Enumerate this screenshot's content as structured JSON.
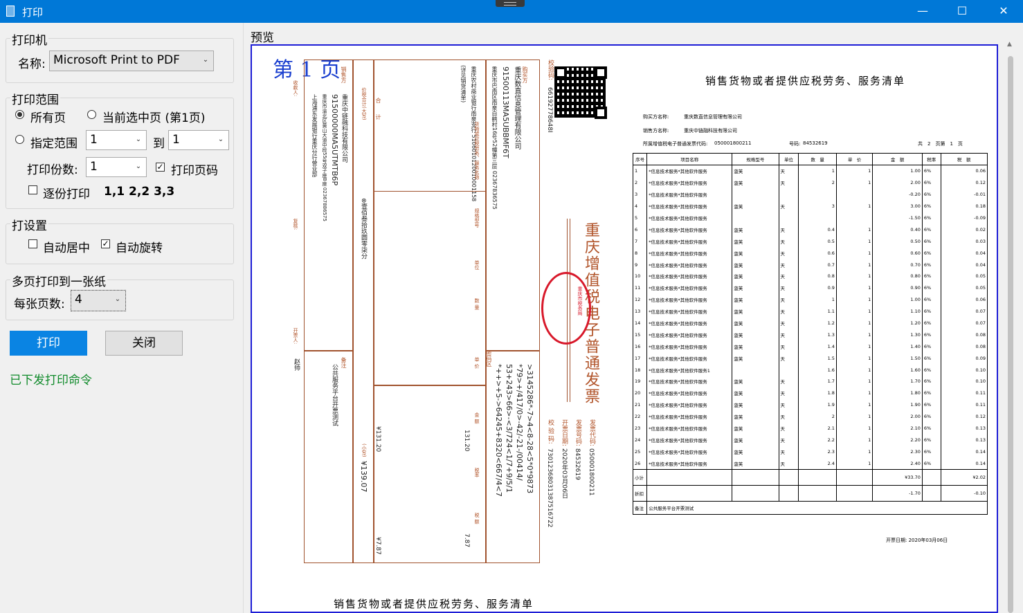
{
  "window": {
    "title": "打印",
    "minimize": "—",
    "maximize": "☐",
    "close": "✕"
  },
  "printer": {
    "group": "打印机",
    "name_label": "名称:",
    "name_value": "Microsoft Print to PDF"
  },
  "range": {
    "group": "打印范围",
    "all_pages": "所有页",
    "current_page": "当前选中页 (第1页)",
    "specified": "指定范围",
    "from": "1",
    "to_label": "到",
    "to": "1",
    "copies_label": "打印份数:",
    "copies": "1",
    "print_page_numbers": "打印页码",
    "collate": "逐份打印",
    "collate_example": "1,1 2,2 3,3"
  },
  "settings": {
    "group": "打设置",
    "center": "自动居中",
    "rotate": "自动旋转"
  },
  "multipage": {
    "group": "多页打印到一张纸",
    "per_sheet_label": "每张页数:",
    "per_sheet": "4"
  },
  "buttons": {
    "print": "打印",
    "close": "关闭"
  },
  "status": "已下发打印命令",
  "preview": {
    "label": "预览",
    "page_label": "第 1 页",
    "invoice": {
      "code_label": "校验码:",
      "code_value": "66192778648I",
      "buyer_name_label": "名　　　称:",
      "buyer_name": "重庆数直信息管理有限公司",
      "buyer_tax_label": "纳税人识别号:",
      "buyer_tax": "91500113MA5UBBMF6T",
      "buyer_addr_label": "地址、电话:",
      "buyer_addr": "重庆市巴南区南泉白鹤村16号52幢第三层 02367836575",
      "buyer_bank_label": "开户行及账号:",
      "buyer_bank": "重庆农村商业银行南泉支行 5106010120010001158",
      "buyer_side": "购买方",
      "password_label": "密码区",
      "password": [
        ">3145286*-7>4<8-28<5*0*9873",
        "*79>+/417/0>-42/-21-/00414/",
        "53+243>66>-<3/724<1/7+9/5/1",
        "*++>+5->64245+8320<667/4<7"
      ],
      "goods_col": "货物或应税劳务、服务名称",
      "goods_value": "(详见销货清单)",
      "spec_col": "规格型号",
      "unit_col": "单位",
      "qty_col": "数 量",
      "price_col": "单 价",
      "amount_col": "金 额",
      "tax_rate_col": "税率",
      "tax_col": "税 额",
      "amount": "131.20",
      "tax": "7.87",
      "total_label": "合　　计",
      "total_amount": "¥131.20",
      "total_tax": "¥7.87",
      "grand_label": "价税合计(大写)",
      "grand_words": "⊗壹佰叁拾玖圆零柒分",
      "grand_small_label": "(小写)",
      "grand_small": "¥139.07",
      "seller_side": "销售方",
      "seller_name": "重庆中链融科技有限公司",
      "seller_tax": "91500000MA5UTMTB6P",
      "seller_addr": "重庆市渝北区黄山大道中段55号双子座B座 02367886575",
      "seller_bank": "上海浦东发展银行重庆分行营业部",
      "remarks_label": "备注",
      "remarks": "公共服务平台开票测试",
      "payee_label": "收款人:",
      "reviewer_label": "复核:",
      "drawer_label": "开票人:",
      "drawer": "赵帅",
      "invoice_title": "重庆增值税电子普通发票",
      "inv_code_label": "发票代码:",
      "inv_code": "050001800211",
      "inv_no_label": "发票号码:",
      "inv_no": "84532619",
      "date_label": "开票日期:",
      "date": "2020年03月06日",
      "check_label": "校 验 码:",
      "check": "73012368031387516722"
    },
    "list": {
      "title": "销售货物或者提供应税劳务、服务清单",
      "buyer_label": "购买方名称:",
      "buyer": "重庆数直信息管理有限公司",
      "seller_label": "销售方名称:",
      "seller": "重庆中链融科技有限公司",
      "code_label": "所属增值税电子普通发票代码:",
      "code": "050001800211",
      "no_label": "号码:",
      "no": "84532619",
      "pages_total": "共　2　页第　1　页",
      "headers": [
        "序号",
        "项目名称",
        "规格型号",
        "单位",
        "数　量",
        "单　价",
        "金　额",
        "税率",
        "税　额"
      ],
      "rows": [
        [
          "1",
          "*信息技术服务*其他软件服务",
          "菠芙",
          "天",
          "1",
          "1",
          "1.00",
          "6%",
          "0.06"
        ],
        [
          "2",
          "*信息技术服务*其他软件服务",
          "菠芙",
          "天",
          "2",
          "1",
          "2.00",
          "6%",
          "0.12"
        ],
        [
          "3",
          "*信息技术服务*其他软件服务",
          "",
          "",
          "",
          "",
          "-0.20",
          "6%",
          "-0.01"
        ],
        [
          "4",
          "*信息技术服务*其他软件服务",
          "菠芙",
          "天",
          "3",
          "1",
          "3.00",
          "6%",
          "0.18"
        ],
        [
          "5",
          "*信息技术服务*其他软件服务",
          "",
          "",
          "",
          "",
          "-1.50",
          "6%",
          "-0.09"
        ],
        [
          "6",
          "*信息技术服务*其他软件服务",
          "菠芙",
          "天",
          "0.4",
          "1",
          "0.40",
          "6%",
          "0.02"
        ],
        [
          "7",
          "*信息技术服务*其他软件服务",
          "菠芙",
          "天",
          "0.5",
          "1",
          "0.50",
          "6%",
          "0.03"
        ],
        [
          "8",
          "*信息技术服务*其他软件服务",
          "菠芙",
          "天",
          "0.6",
          "1",
          "0.60",
          "6%",
          "0.04"
        ],
        [
          "9",
          "*信息技术服务*其他软件服务",
          "菠芙",
          "天",
          "0.7",
          "1",
          "0.70",
          "6%",
          "0.04"
        ],
        [
          "10",
          "*信息技术服务*其他软件服务",
          "菠芙",
          "天",
          "0.8",
          "1",
          "0.80",
          "6%",
          "0.05"
        ],
        [
          "11",
          "*信息技术服务*其他软件服务",
          "菠芙",
          "天",
          "0.9",
          "1",
          "0.90",
          "6%",
          "0.05"
        ],
        [
          "12",
          "*信息技术服务*其他软件服务",
          "菠芙",
          "天",
          "1",
          "1",
          "1.00",
          "6%",
          "0.06"
        ],
        [
          "13",
          "*信息技术服务*其他软件服务",
          "菠芙",
          "天",
          "1.1",
          "1",
          "1.10",
          "6%",
          "0.07"
        ],
        [
          "14",
          "*信息技术服务*其他软件服务",
          "菠芙",
          "天",
          "1.2",
          "1",
          "1.20",
          "6%",
          "0.07"
        ],
        [
          "15",
          "*信息技术服务*其他软件服务",
          "菠芙",
          "天",
          "1.3",
          "1",
          "1.30",
          "6%",
          "0.08"
        ],
        [
          "16",
          "*信息技术服务*其他软件服务",
          "菠芙",
          "天",
          "1.4",
          "1",
          "1.40",
          "6%",
          "0.08"
        ],
        [
          "17",
          "*信息技术服务*其他软件服务",
          "菠芙",
          "天",
          "1.5",
          "1",
          "1.50",
          "6%",
          "0.09"
        ],
        [
          "18",
          "*信息技术服务*其他软件服务1",
          "",
          "",
          "1.6",
          "1",
          "1.60",
          "6%",
          "0.10"
        ],
        [
          "19",
          "*信息技术服务*其他软件服务",
          "菠芙",
          "天",
          "1.7",
          "1",
          "1.70",
          "6%",
          "0.10"
        ],
        [
          "20",
          "*信息技术服务*其他软件服务",
          "菠芙",
          "天",
          "1.8",
          "1",
          "1.80",
          "6%",
          "0.11"
        ],
        [
          "21",
          "*信息技术服务*其他软件服务",
          "菠芙",
          "天",
          "1.9",
          "1",
          "1.90",
          "6%",
          "0.11"
        ],
        [
          "22",
          "*信息技术服务*其他软件服务",
          "菠芙",
          "天",
          "2",
          "1",
          "2.00",
          "6%",
          "0.12"
        ],
        [
          "23",
          "*信息技术服务*其他软件服务",
          "菠芙",
          "天",
          "2.1",
          "1",
          "2.10",
          "6%",
          "0.13"
        ],
        [
          "24",
          "*信息技术服务*其他软件服务",
          "菠芙",
          "天",
          "2.2",
          "1",
          "2.20",
          "6%",
          "0.13"
        ],
        [
          "25",
          "*信息技术服务*其他软件服务",
          "菠芙",
          "天",
          "2.3",
          "1",
          "2.30",
          "6%",
          "0.14"
        ],
        [
          "26",
          "*信息技术服务*其他软件服务",
          "菠芙",
          "天",
          "2.4",
          "1",
          "2.40",
          "6%",
          "0.14"
        ]
      ],
      "subtotal_label": "小计",
      "subtotal_amount": "¥33.70",
      "subtotal_tax": "¥2.02",
      "discount_label": "折扣",
      "discount_amount": "-1.70",
      "discount_tax": "-0.10",
      "remarks_label": "备注",
      "remarks": "公共服务平台开票测试",
      "date": "开票日期: 2020年03月06日"
    },
    "bottom_title": "销售货物或者提供应税劳务、服务清单"
  }
}
